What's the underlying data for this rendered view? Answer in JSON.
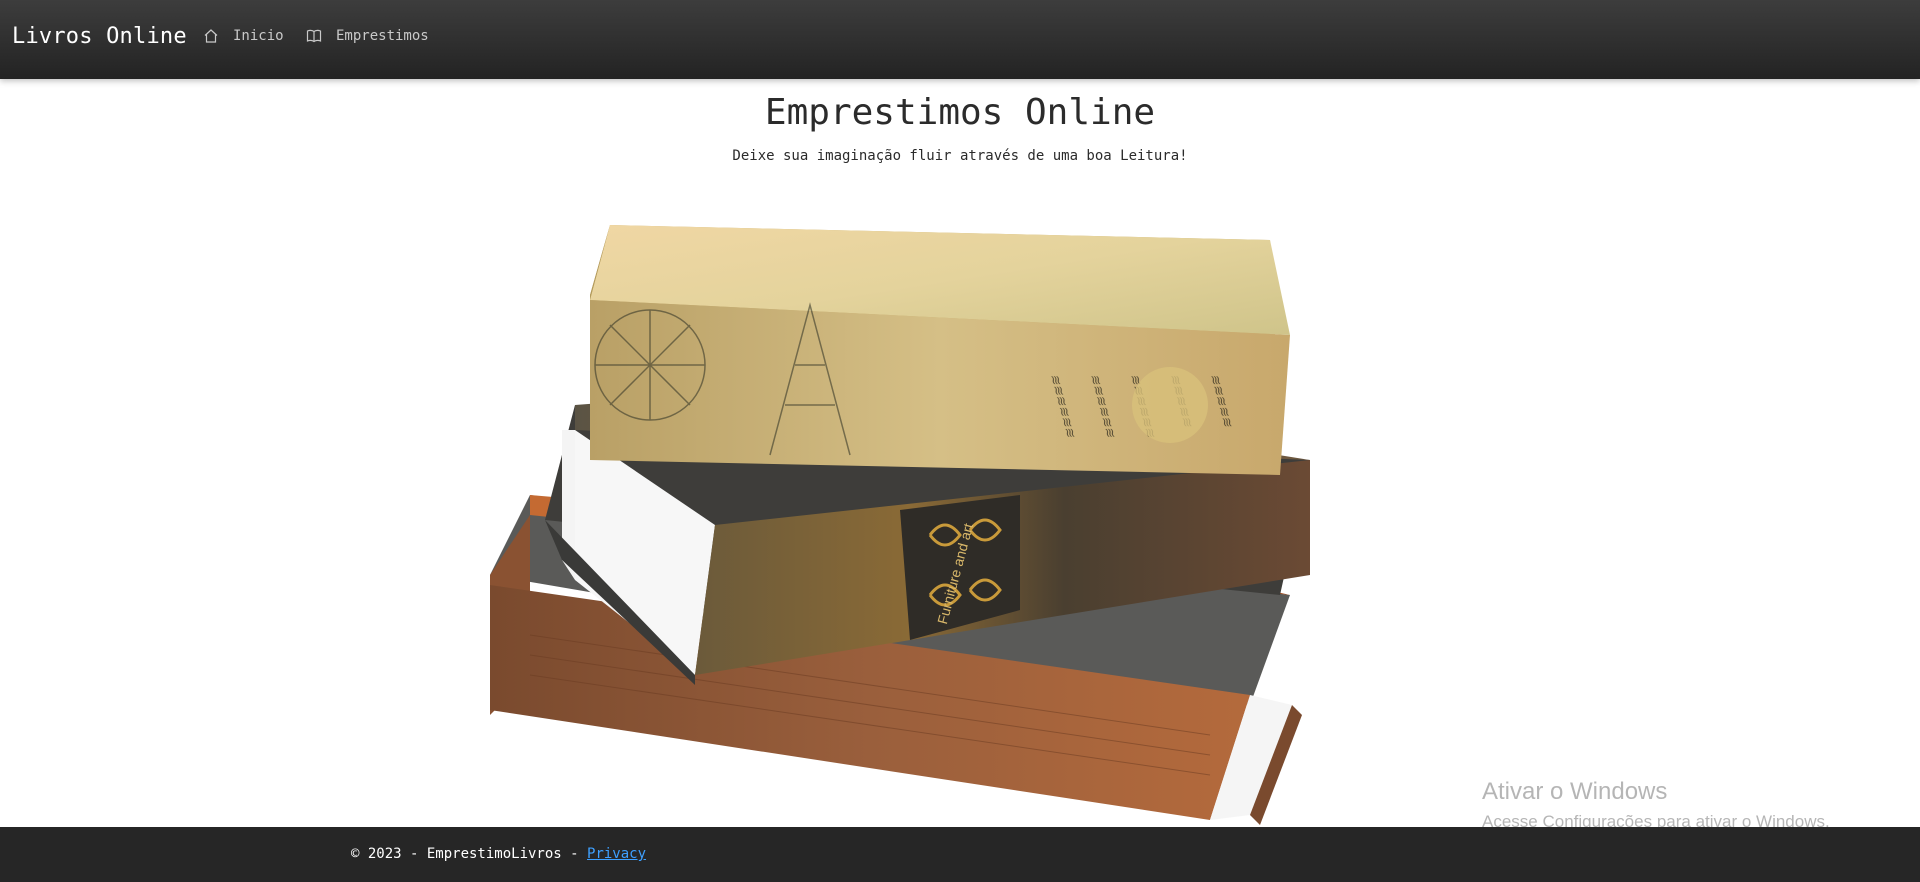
{
  "navbar": {
    "brand": "Livros Online",
    "items": [
      {
        "label": "Inicio",
        "icon": "home-icon"
      },
      {
        "label": "Emprestimos",
        "icon": "book-icon"
      }
    ]
  },
  "hero": {
    "title": "Emprestimos Online",
    "subtitle": "Deixe sua imaginação fluir através de uma boa Leitura!",
    "image_label": "Furniture and art"
  },
  "watermark": {
    "title": "Ativar o Windows",
    "subtitle": "Acesse Configurações para ativar o Windows."
  },
  "footer": {
    "copyright": "© 2023 - EmprestimoLivros - ",
    "privacy_link": "Privacy"
  },
  "colors": {
    "navbar": "#2d2d2d",
    "footer": "#262626",
    "link": "#3ea0ff"
  }
}
